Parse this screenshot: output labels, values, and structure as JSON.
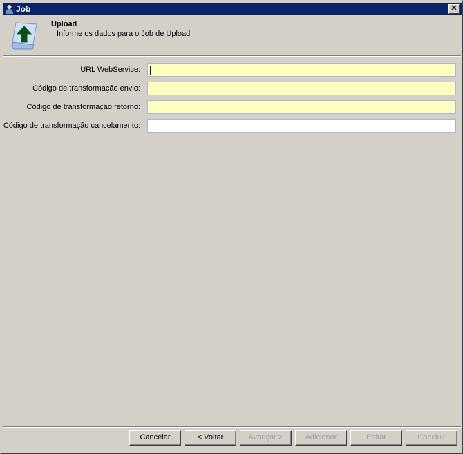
{
  "window": {
    "title": "Job"
  },
  "header": {
    "title": "Upload",
    "subtitle": "Informe os dados para o Job de Upload"
  },
  "fields": [
    {
      "label": "URL WebService:",
      "value": ""
    },
    {
      "label": "Código de transformação envio:",
      "value": ""
    },
    {
      "label": "Código de transformação retorno:",
      "value": ""
    },
    {
      "label": "Código de transformação cancelamento:",
      "value": ""
    }
  ],
  "buttons": {
    "cancel": "Cancelar",
    "back": "< Voltar",
    "next": "Avançar >",
    "add": "Adicionar",
    "edit": "Editar",
    "finish": "Concluir"
  }
}
